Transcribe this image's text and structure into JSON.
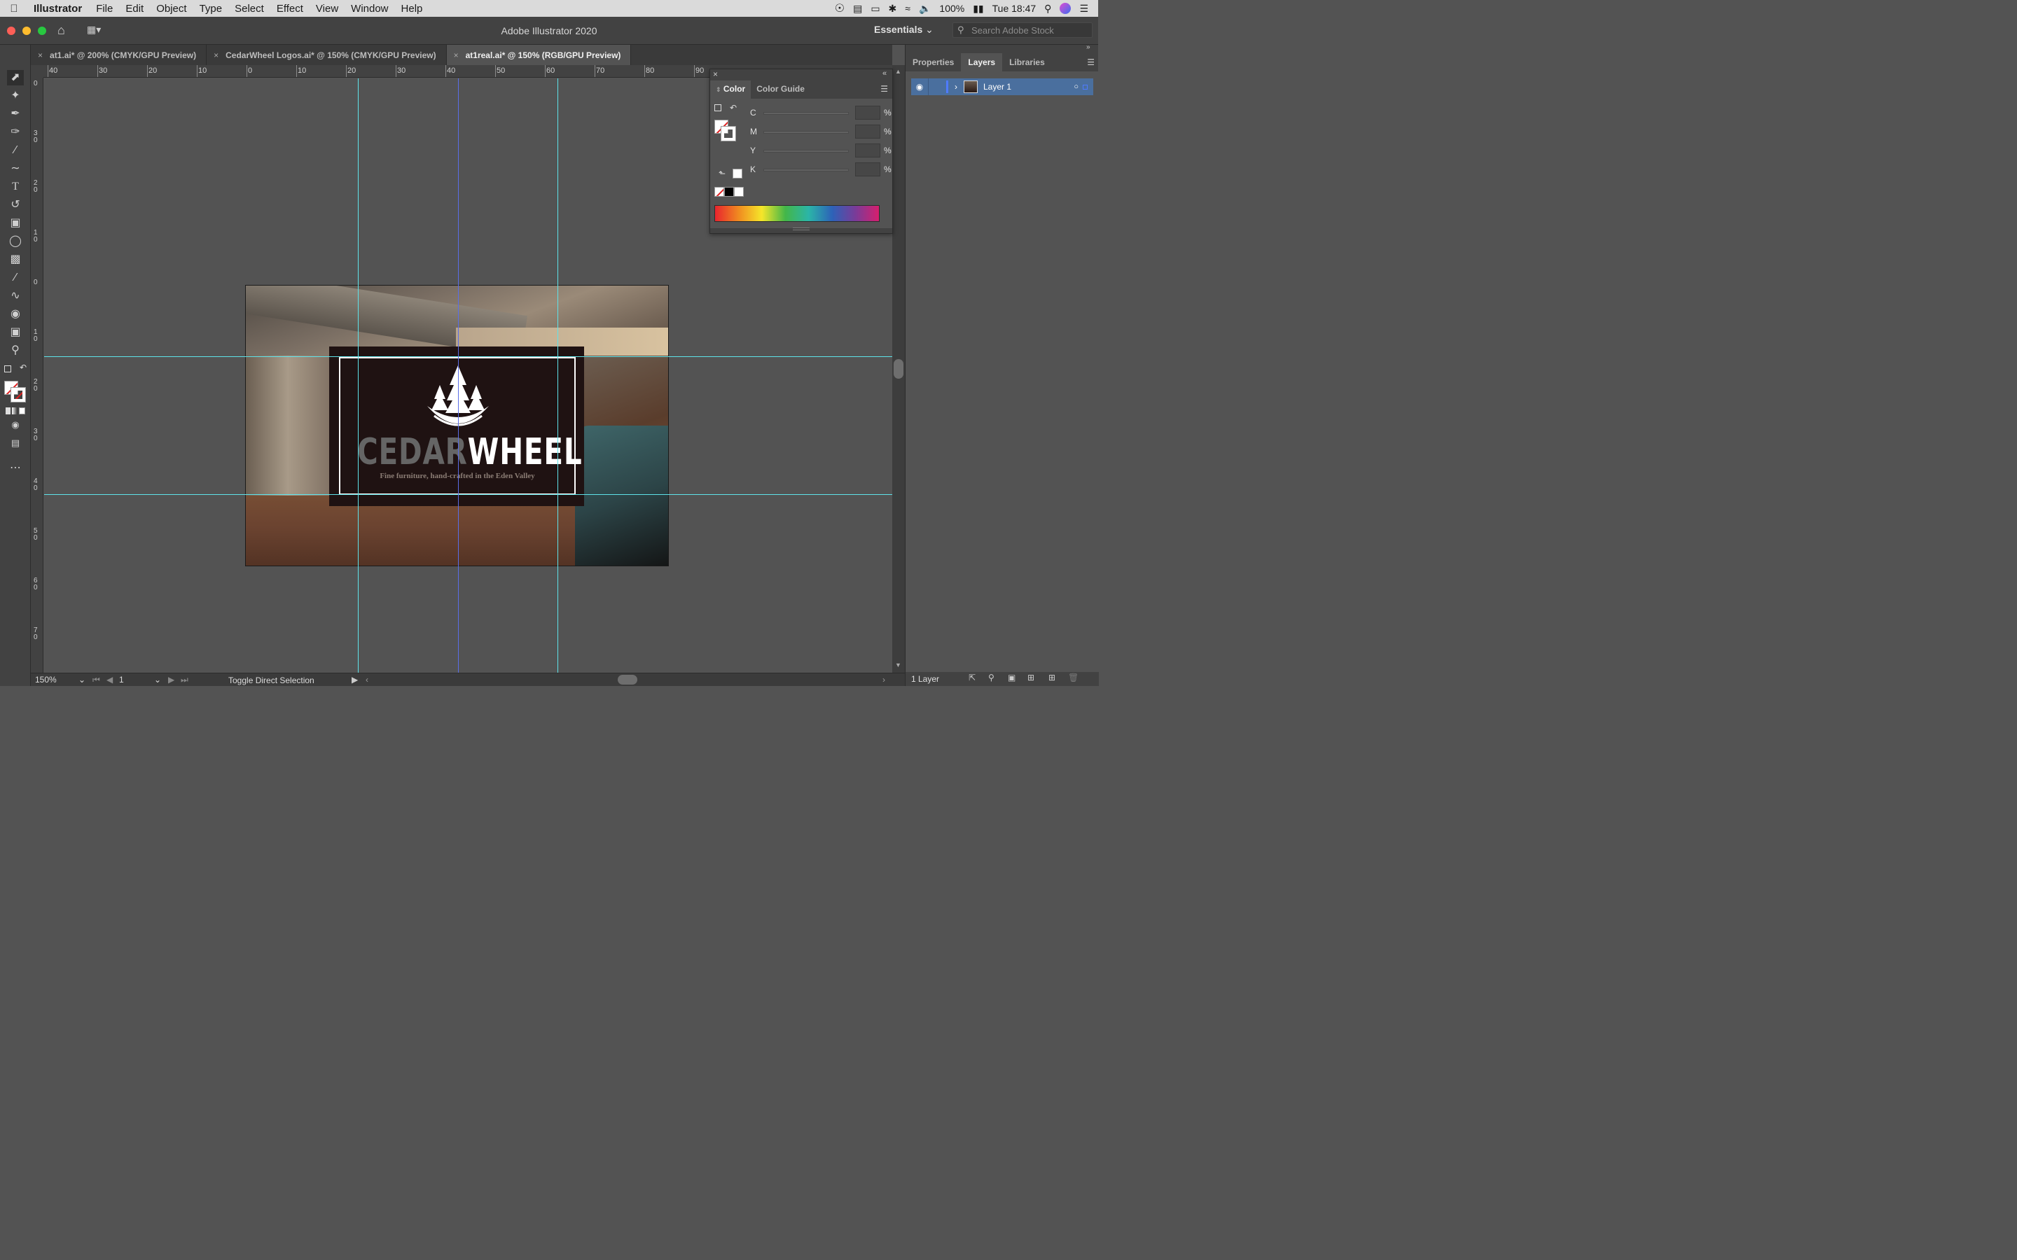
{
  "menubar": {
    "app": "Illustrator",
    "items": [
      "File",
      "Edit",
      "Object",
      "Type",
      "Select",
      "Effect",
      "View",
      "Window",
      "Help"
    ],
    "battery": "100%",
    "clock": "Tue 18:47"
  },
  "window": {
    "title": "Adobe Illustrator 2020",
    "workspace": "Essentials",
    "stock_placeholder": "Search Adobe Stock"
  },
  "tabs": [
    {
      "label": "at1.ai* @ 200% (CMYK/GPU Preview)",
      "active": false
    },
    {
      "label": "CedarWheel Logos.ai* @ 150% (CMYK/GPU Preview)",
      "active": false
    },
    {
      "label": "at1real.ai* @ 150% (RGB/GPU Preview)",
      "active": true
    }
  ],
  "rulers": {
    "horizontal": [
      "40",
      "30",
      "20",
      "10",
      "0",
      "10",
      "20",
      "30",
      "40",
      "50",
      "60",
      "70",
      "80",
      "90"
    ],
    "vertical": [
      "0",
      "3\n0",
      "2\n0",
      "1\n0",
      "0",
      "1\n0",
      "2\n0",
      "3\n0",
      "4\n0",
      "5\n0",
      "6\n0",
      "7\n0"
    ]
  },
  "artwork": {
    "brand_left": "CEDAR",
    "brand_right": "WHEEL",
    "tagline": "Fine furniture, hand-crafted in the Eden Valley"
  },
  "color_panel": {
    "tabs": [
      "Color",
      "Color Guide"
    ],
    "channels": [
      {
        "label": "C",
        "value": ""
      },
      {
        "label": "M",
        "value": ""
      },
      {
        "label": "Y",
        "value": ""
      },
      {
        "label": "K",
        "value": ""
      }
    ],
    "pct": "%"
  },
  "right_panel": {
    "tabs": [
      "Properties",
      "Layers",
      "Libraries"
    ],
    "active_tab": "Layers",
    "layer_name": "Layer 1",
    "footer": "1 Layer"
  },
  "status": {
    "zoom": "150%",
    "artboard": "1",
    "tool_hint": "Toggle Direct Selection"
  },
  "colors": {
    "guide": "#5ee3ea",
    "center_guide": "#5a6ee8",
    "logo_bg": "#1f1212",
    "layer_highlight": "#4a6f9e"
  }
}
